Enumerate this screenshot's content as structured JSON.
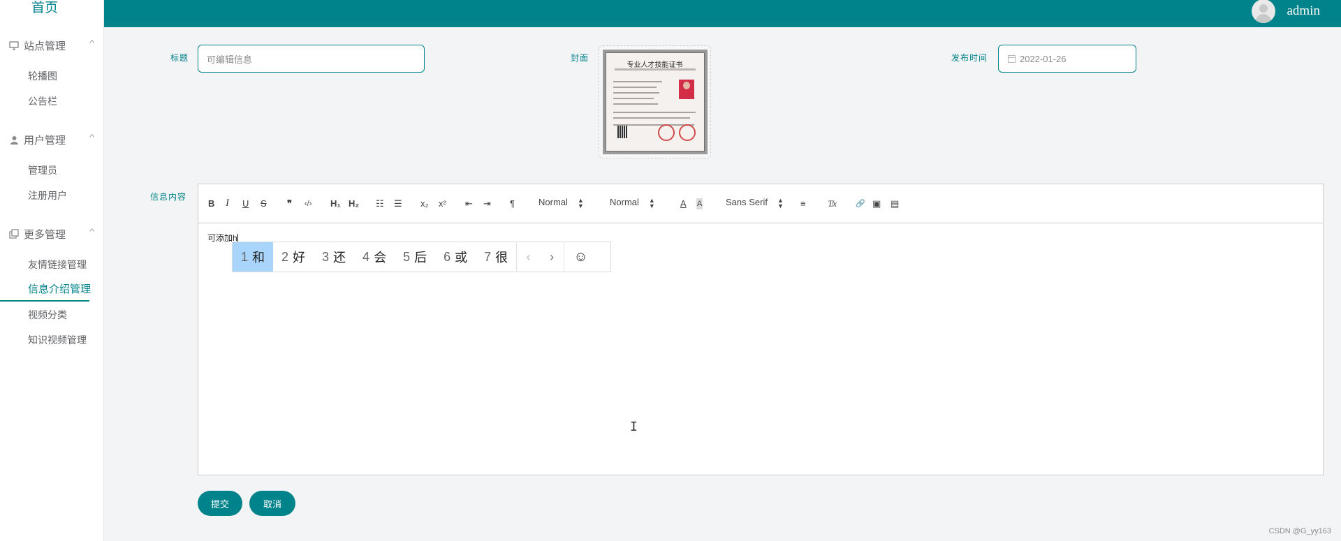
{
  "header": {
    "username": "admin",
    "avatar_icon": "user-avatar-icon"
  },
  "sidebar": {
    "home": "首页",
    "groups": [
      {
        "label": "站点管理",
        "icon": "monitor-icon",
        "items": [
          "轮播图",
          "公告栏"
        ]
      },
      {
        "label": "用户管理",
        "icon": "user-icon",
        "items": [
          "管理员",
          "注册用户"
        ]
      },
      {
        "label": "更多管理",
        "icon": "copy-icon",
        "items": [
          "友情链接管理",
          "信息介绍管理",
          "视频分类",
          "知识视频管理"
        ]
      }
    ],
    "active_item": "信息介绍管理"
  },
  "form": {
    "title_label": "标题",
    "title_placeholder": "可编辑信息",
    "cover_label": "封面",
    "cover_image": {
      "title": "专业人才技能证书",
      "alt": "certificate image"
    },
    "date_label": "发布时间",
    "date_value": "2022-01-26",
    "content_label": "信息内容"
  },
  "editor": {
    "toolbar": {
      "bold": "B",
      "italic": "I",
      "underline": "U",
      "strike": "S",
      "quote": "❞",
      "code": "‹/›",
      "h1": "H₁",
      "h2": "H₂",
      "ordered_list": "☷",
      "bullet_list": "☰",
      "sub": "x₂",
      "sup": "x²",
      "outdent": "⇤",
      "indent": "⇥",
      "direction": "¶",
      "size_picker": "Normal",
      "header_picker": "Normal",
      "color": "A",
      "background": "A",
      "font_picker": "Sans Serif",
      "align": "≡",
      "clean": "T̸x",
      "link": "🔗",
      "image": "▣",
      "video": "▤"
    },
    "content": "可添加h"
  },
  "ime": {
    "candidates": [
      {
        "num": "1",
        "text": "和"
      },
      {
        "num": "2",
        "text": "好"
      },
      {
        "num": "3",
        "text": "还"
      },
      {
        "num": "4",
        "text": "会"
      },
      {
        "num": "5",
        "text": "后"
      },
      {
        "num": "6",
        "text": "或"
      },
      {
        "num": "7",
        "text": "很"
      }
    ],
    "prev": "‹",
    "next": "›",
    "emoji": "☺"
  },
  "buttons": {
    "submit": "提交",
    "cancel": "取消"
  },
  "watermark": "CSDN @G_yy163",
  "colors": {
    "accent": "#00838a",
    "ime_selected": "#a9d4fb"
  }
}
